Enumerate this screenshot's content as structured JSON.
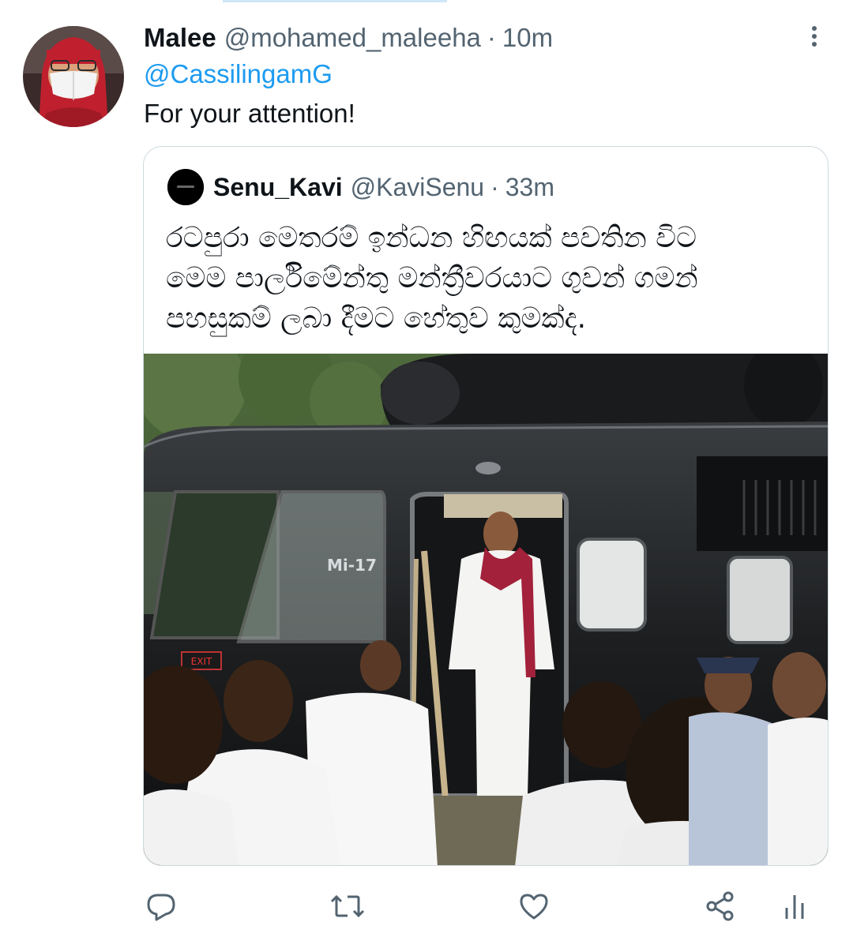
{
  "tweet": {
    "display_name": "Malee",
    "handle": "@mohamed_maleeha",
    "separator": "·",
    "time": "10m",
    "mention": "@CassilingamG",
    "text": "For your attention!"
  },
  "quoted_tweet": {
    "display_name": "Senu_Kavi",
    "handle": "@KaviSenu",
    "separator": "·",
    "time": "33m",
    "text_lines": [
      "රටපුරා මෙතරම් ඉන්ධන හිඟයක් පවතින විට",
      "මෙම පාර්ලිමේන්තු මන්ත්‍රීවරයාට ගුවන් ගමන්",
      "පහසුකම් ලබා දීමට හේතුව කුමක්ද."
    ],
    "media": {
      "description_icon": "photo",
      "aircraft_marking": "Mi-17",
      "exit_sign": "EXIT"
    }
  },
  "actions": [
    {
      "name": "reply",
      "icon": "reply-icon"
    },
    {
      "name": "retweet",
      "icon": "retweet-icon"
    },
    {
      "name": "like",
      "icon": "heart-icon"
    },
    {
      "name": "share",
      "icon": "share-icon"
    },
    {
      "name": "analytics",
      "icon": "analytics-icon"
    }
  ],
  "colors": {
    "link": "#1d9bf0",
    "secondary_text": "#536471",
    "border": "#cfd9de",
    "primary_text": "#0f1419"
  }
}
